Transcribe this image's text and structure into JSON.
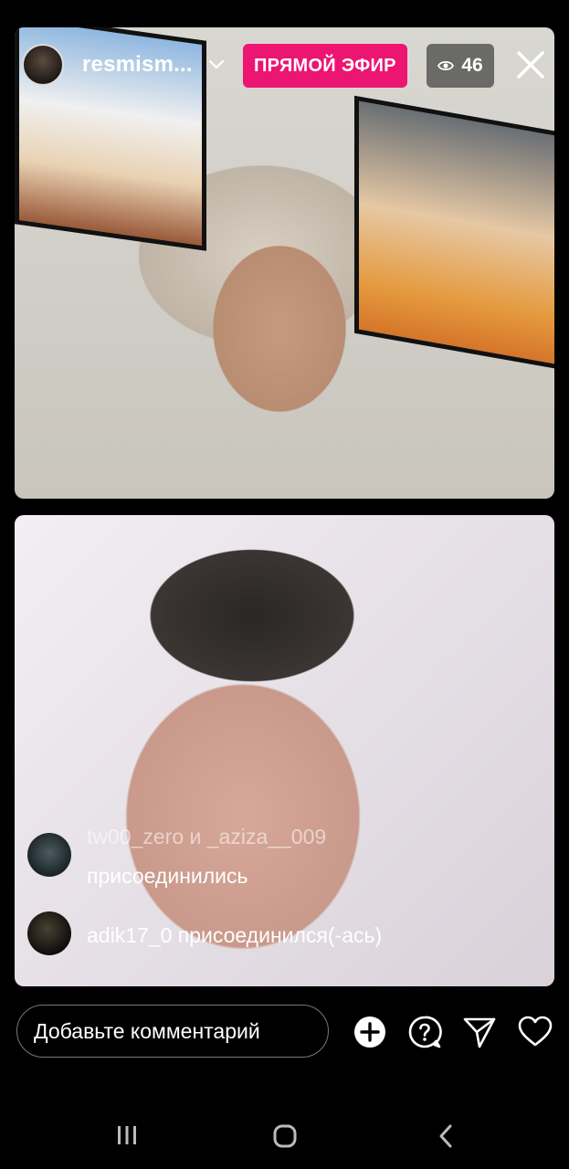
{
  "header": {
    "username": "resmism...",
    "live_label": "ПРЯМОЙ ЭФИР",
    "viewer_count": "46"
  },
  "messages": [
    {
      "users": "tw00_zero и _aziza__009",
      "action": "присоединились"
    },
    {
      "text": "adik17_0 присоединился(-ась)"
    }
  ],
  "comment_bar": {
    "placeholder": "Добавьте комментарий"
  },
  "icons": {
    "avatar": "avatar-icon",
    "chevron": "chevron-down-icon",
    "eye": "eye-icon",
    "close": "close-icon",
    "add": "plus-circle-icon",
    "question": "question-bubble-icon",
    "send": "paper-plane-icon",
    "like": "heart-icon",
    "nav_recents": "recents-icon",
    "nav_home": "home-icon",
    "nav_back": "back-icon"
  },
  "colors": {
    "live_badge": "#ec1571",
    "background": "#000000"
  }
}
